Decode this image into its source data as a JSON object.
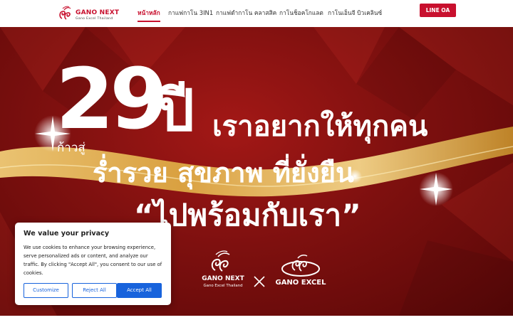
{
  "header": {
    "logo": {
      "name": "GANO NEXT",
      "subtitle": "Gano Excel Thailand"
    },
    "nav": [
      {
        "label": "หน้าหลัก",
        "active": true
      },
      {
        "label": "กาแฟกาโน 3IN1",
        "active": false
      },
      {
        "label": "กาแฟดำกาโน คลาสสิค",
        "active": false
      },
      {
        "label": "กาโนช็อคโกแลต",
        "active": false
      },
      {
        "label": "กาโนเอ็นจี บิวเคลินซ์",
        "active": false
      }
    ],
    "cta_label": "LINE OA"
  },
  "hero": {
    "number": "29",
    "year_word": "ปี",
    "towards": "ก้าวสู่",
    "line1": "เราอยากให้ทุกคน",
    "line2": "ร่ำรวย สุขภาพ ที่ยั่งยืน",
    "line3": "“ไปพร้อมกับเรา”",
    "brand_left_name": "GANO NEXT",
    "brand_left_sub": "Gano Excel Thailand",
    "brand_right_name": "GANO EXCEL",
    "colors": {
      "background": "#7e100f",
      "gold": "#e8c25a",
      "text": "#ffffff"
    }
  },
  "cookie_banner": {
    "title": "We value your privacy",
    "body": "We use cookies to enhance your browsing experience, serve personalized ads or content, and analyze our traffic. By clicking \"Accept All\", you consent to our use of cookies.",
    "customize_label": "Customize",
    "reject_label": "Reject All",
    "accept_label": "Accept All",
    "accent_color": "#1863dc"
  },
  "colors": {
    "brand_red": "#c8102e"
  }
}
